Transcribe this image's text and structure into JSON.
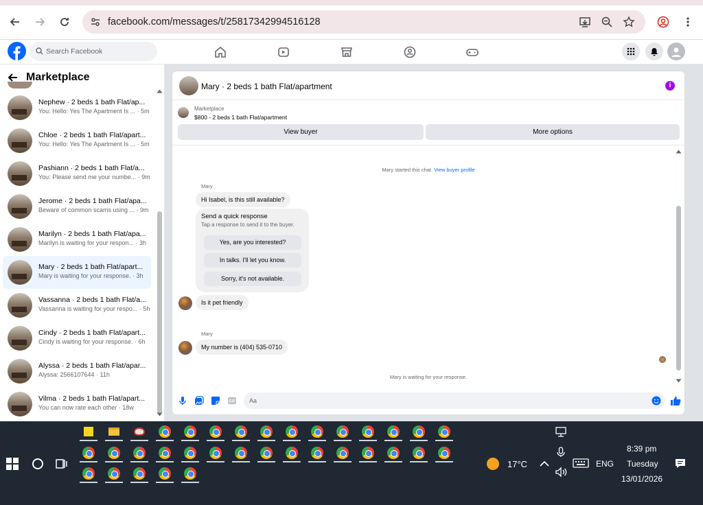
{
  "browser": {
    "url": "facebook.com/messages/t/25817342994516128"
  },
  "fb": {
    "search_placeholder": "Search Facebook"
  },
  "left": {
    "title": "Marketplace",
    "conversations": [
      {
        "name": "Nephew · 2 beds 1 bath Flat/ap...",
        "snippet": "You: Hello: Yes The Apartment Is ... · 5m",
        "selected": false
      },
      {
        "name": "Chloe · 2 beds 1 bath Flat/apart...",
        "snippet": "You: Hello: Yes The Apartment Is ... · 5m",
        "selected": false
      },
      {
        "name": "Pashiann · 2 beds 1 bath Flat/a...",
        "snippet": "You: Please send me your numbe... · 9m",
        "selected": false
      },
      {
        "name": "Jerome · 2 beds 1 bath Flat/apa...",
        "snippet": "Beware of common scams using ... · 9m",
        "selected": false
      },
      {
        "name": "Marilyn · 2 beds 1 bath Flat/apa...",
        "snippet": "Marilyn is waiting for your respon... · 3h",
        "selected": false
      },
      {
        "name": "Mary · 2 beds 1 bath Flat/apart...",
        "snippet": "Mary is waiting for your response. · 3h",
        "selected": true
      },
      {
        "name": "Vassanna · 2 beds 1 bath Flat/a...",
        "snippet": "Vassanna is waiting for your respo... · 5h",
        "selected": false
      },
      {
        "name": "Cindy · 2 beds 1 bath Flat/apart...",
        "snippet": "Cindy is waiting for your response. · 6h",
        "selected": false
      },
      {
        "name": "Alyssa · 2 beds 1 bath Flat/apar...",
        "snippet": "Alyssa: 2566107644 · 11h",
        "selected": false
      },
      {
        "name": "Vilma · 2 beds 1 bath Flat/apart...",
        "snippet": "You can now rate each other · 18w",
        "selected": false
      }
    ]
  },
  "chat": {
    "title": "Mary · 2 beds 1 bath Flat/apartment",
    "marketplace_label": "Marketplace",
    "listing": "$800 - 2 beds 1 bath Flat/apartment",
    "view_buyer": "View buyer",
    "more_options": "More options",
    "started_text": "Mary started this chat.",
    "view_profile": "View buyer profile",
    "sender_name": "Mary",
    "msg1": "Hi Isabel, is this still available?",
    "quick_title": "Send a quick response",
    "quick_sub": "Tap a response to send it to the buyer.",
    "quick_replies": [
      "Yes, are you interested?",
      "In talks. I'll let you know.",
      "Sorry, it's not available."
    ],
    "msg2": "Is it pet friendly",
    "msg3": "My number is (404) 535-0710",
    "waiting": "Mary is waiting for your response.",
    "composer_placeholder": "Aa",
    "accent": "#0866ff"
  },
  "taskbar": {
    "temperature": "17°C",
    "language": "ENG",
    "time": "8:39 pm",
    "day": "Tuesday",
    "date": "13/01/2026"
  }
}
